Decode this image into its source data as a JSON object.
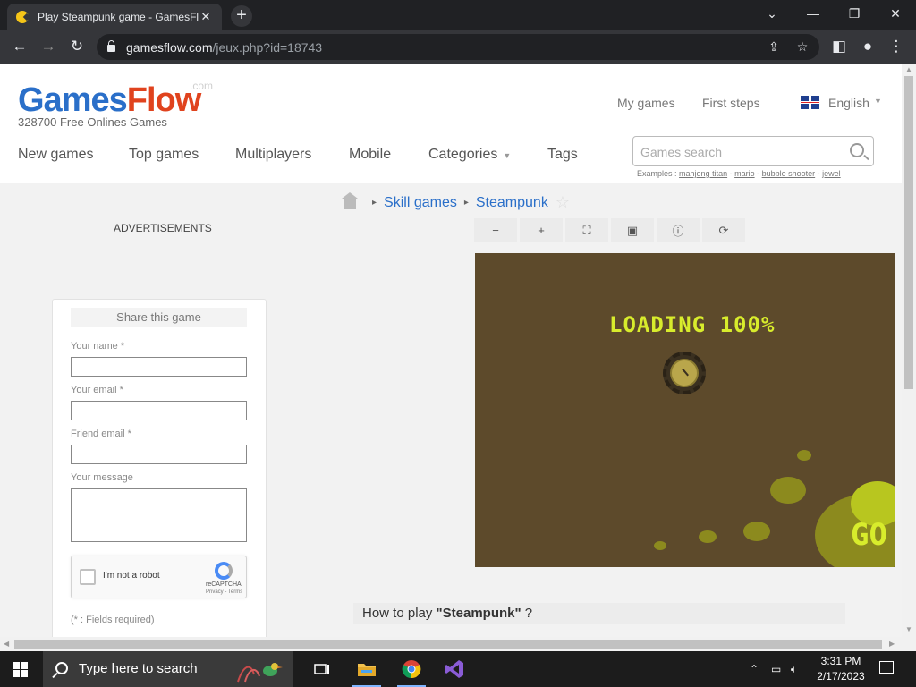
{
  "browser": {
    "tab_title": "Play Steampunk game - GamesFlow",
    "tab_close": "✕",
    "new_tab": "+",
    "url_host": "gamesflow.com",
    "url_path": "/jeux.php?id=18743",
    "window_controls": {
      "dropdown": "⌄",
      "minimize": "—",
      "restore": "❐",
      "close": "✕"
    }
  },
  "site": {
    "logo_games": "Games",
    "logo_flow": "Flow",
    "logo_com": ".com",
    "tagline": "328700 Free Onlines Games",
    "top_links": {
      "my_games": "My games",
      "first_steps": "First steps"
    },
    "language": "English",
    "nav": [
      "New games",
      "Top games",
      "Multiplayers",
      "Mobile",
      "Categories",
      "Tags"
    ],
    "search_placeholder": "Games search",
    "examples_prefix": "Examples :",
    "examples": [
      "mahjong titan",
      "mario",
      "bubble shooter",
      "jewel"
    ]
  },
  "breadcrumb": {
    "category": "Skill games",
    "game": "Steampunk"
  },
  "game_tools": [
    {
      "name": "zoom-out-icon",
      "glyph": "−"
    },
    {
      "name": "zoom-in-icon",
      "glyph": "+"
    },
    {
      "name": "fullscreen-icon",
      "glyph": "⛶"
    },
    {
      "name": "fit-icon",
      "glyph": "▣"
    },
    {
      "name": "info-icon",
      "glyph": "ⓘ"
    },
    {
      "name": "reload-icon",
      "glyph": "⟳"
    }
  ],
  "game": {
    "loading_text": "LOADING 100%",
    "go_text": "GO"
  },
  "sidebar": {
    "ads_label": "ADVERTISEMENTS",
    "share_title": "Share this game",
    "fields": {
      "name_label": "Your name *",
      "email_label": "Your email *",
      "friend_label": "Friend email *",
      "message_label": "Your message"
    },
    "captcha": {
      "text": "I'm not a robot",
      "brand": "reCAPTCHA",
      "terms": "Privacy - Terms"
    },
    "required_note": "(* : Fields required)"
  },
  "howto": {
    "prefix": "How to play ",
    "game": "\"Steampunk\"",
    "suffix": " ?"
  },
  "taskbar": {
    "search_placeholder": "Type here to search",
    "time": "3:31 PM",
    "date": "2/17/2023"
  }
}
